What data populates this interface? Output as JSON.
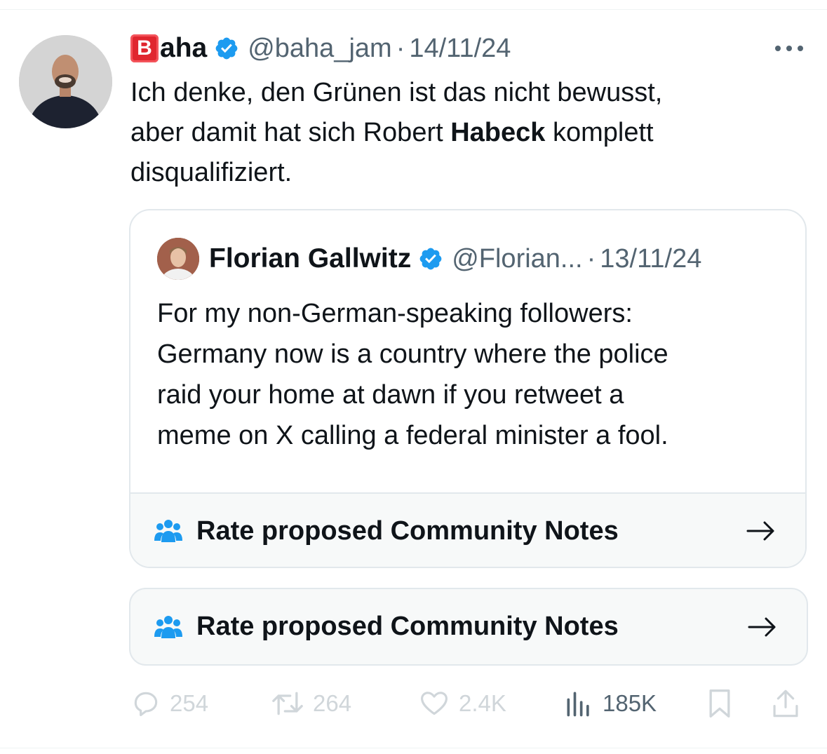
{
  "tweet": {
    "badge_letter": "B",
    "author_name": "aha",
    "handle": "@baha_jam",
    "separator": "·",
    "date": "14/11/24",
    "text_lines": [
      [
        "Ich denke, den Grünen ist das nicht bewusst,"
      ],
      [
        "aber damit hat sich Robert ",
        "Habeck",
        " komplett"
      ],
      [
        "disqualifiziert."
      ]
    ],
    "more_icon": "more-horizontal-icon"
  },
  "quoted_tweet": {
    "author_name": "Florian Gallwitz",
    "handle": "@Florian...",
    "separator": "·",
    "date": "13/11/24",
    "text_lines": [
      "For my non-German-speaking followers:",
      "Germany now is a country where the police",
      "raid your home at dawn if you retweet a",
      "meme on X calling a federal minister a fool."
    ],
    "community_note_label": "Rate proposed Community Notes"
  },
  "community_notes": {
    "label": "Rate proposed Community Notes",
    "icon": "people-icon",
    "arrow": "arrow-right-icon"
  },
  "actions": {
    "replies": "254",
    "retweets": "264",
    "likes": "2.4K",
    "views": "185K"
  },
  "colors": {
    "verified": "#1d9bf0",
    "community_icon": "#1d9bf0",
    "secondary_text": "#536471",
    "muted_counts": "#d0d6da",
    "badge_red": "#e0262f"
  }
}
